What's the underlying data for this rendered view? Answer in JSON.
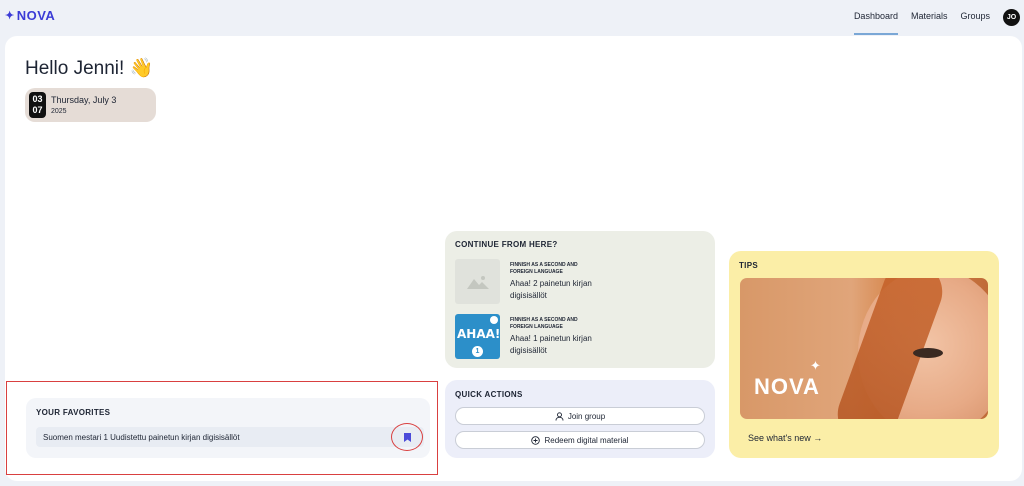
{
  "header": {
    "logo": "NOVA",
    "nav": [
      {
        "label": "Dashboard",
        "active": true
      },
      {
        "label": "Materials",
        "active": false
      },
      {
        "label": "Groups",
        "active": false
      }
    ],
    "avatar_initials": "JO"
  },
  "greeting": "Hello Jenni! 👋",
  "date": {
    "day_num": "03",
    "month_num": "07",
    "weekday_date": "Thursday, July 3",
    "year": "2025"
  },
  "favorites": {
    "title": "YOUR FAVORITES",
    "items": [
      {
        "label": "Suomen mestari 1 Uudistettu painetun kirjan digisisällöt"
      }
    ]
  },
  "continue": {
    "title": "CONTINUE FROM HERE?",
    "items": [
      {
        "category": "FINNISH AS A SECOND AND FOREIGN LANGUAGE",
        "title": "Ahaa! 2 painetun kirjan digisisällöt",
        "thumb": "placeholder-image-icon"
      },
      {
        "category": "FINNISH AS A SECOND AND FOREIGN LANGUAGE",
        "title": "Ahaa! 1 painetun kirjan digisisällöt",
        "thumb": "ahaa-cover",
        "cover_text": "AHAA!",
        "cover_num": "1"
      }
    ]
  },
  "quick_actions": {
    "title": "QUICK ACTIONS",
    "buttons": [
      {
        "label": "Join group",
        "icon": "user-icon"
      },
      {
        "label": "Redeem digital material",
        "icon": "plus-circle-icon"
      }
    ]
  },
  "tips": {
    "title": "TIPS",
    "image_logo": "NOVA",
    "link": "See what's new →"
  },
  "colors": {
    "brand": "#3b3bd6",
    "highlight": "#d94040",
    "tips_bg": "#fbeea7"
  }
}
